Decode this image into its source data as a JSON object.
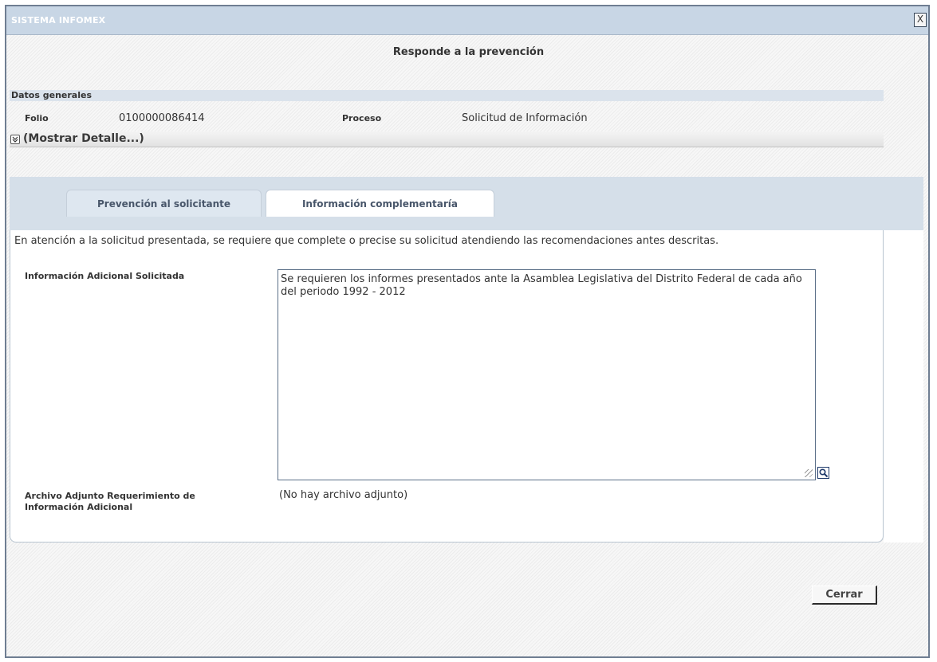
{
  "window": {
    "title": "SISTEMA INFOMEX",
    "close_label": "X",
    "subtitle": "Responde a la prevención"
  },
  "general": {
    "header": "Datos generales",
    "folio_label": "Folio",
    "folio_value": "0100000086414",
    "proceso_label": "Proceso",
    "proceso_value": "Solicitud de Información",
    "detail_link": "(Mostrar Detalle...)"
  },
  "tabs": [
    {
      "label": "Prevención al solicitante",
      "active": true
    },
    {
      "label": "Información complementaría",
      "active": false
    }
  ],
  "panel": {
    "intro": "En atención a la solicitud presentada, se requiere que complete o precise su solicitud atendiendo las recomendaciones antes descritas.",
    "additional_info_label": "Información Adicional Solicitada",
    "additional_info_value": "Se requieren los informes presentados ante la Asamblea Legislativa del Distrito Federal de cada año del periodo 1992 - 2012",
    "attachment_label": "Archivo Adjunto Requerimiento de Información Adicional",
    "attachment_value": "(No hay archivo adjunto)"
  },
  "footer": {
    "close_button": "Cerrar"
  },
  "icons": {
    "expand": "chevron-double-down-icon",
    "zoom": "magnifier-icon",
    "resize": "resize-grip-icon"
  },
  "colors": {
    "titlebar": "#c8d6e5",
    "tabs_band": "#d5dfe9",
    "section_header": "#dbe3ec",
    "window_border": "#6f7e92"
  }
}
